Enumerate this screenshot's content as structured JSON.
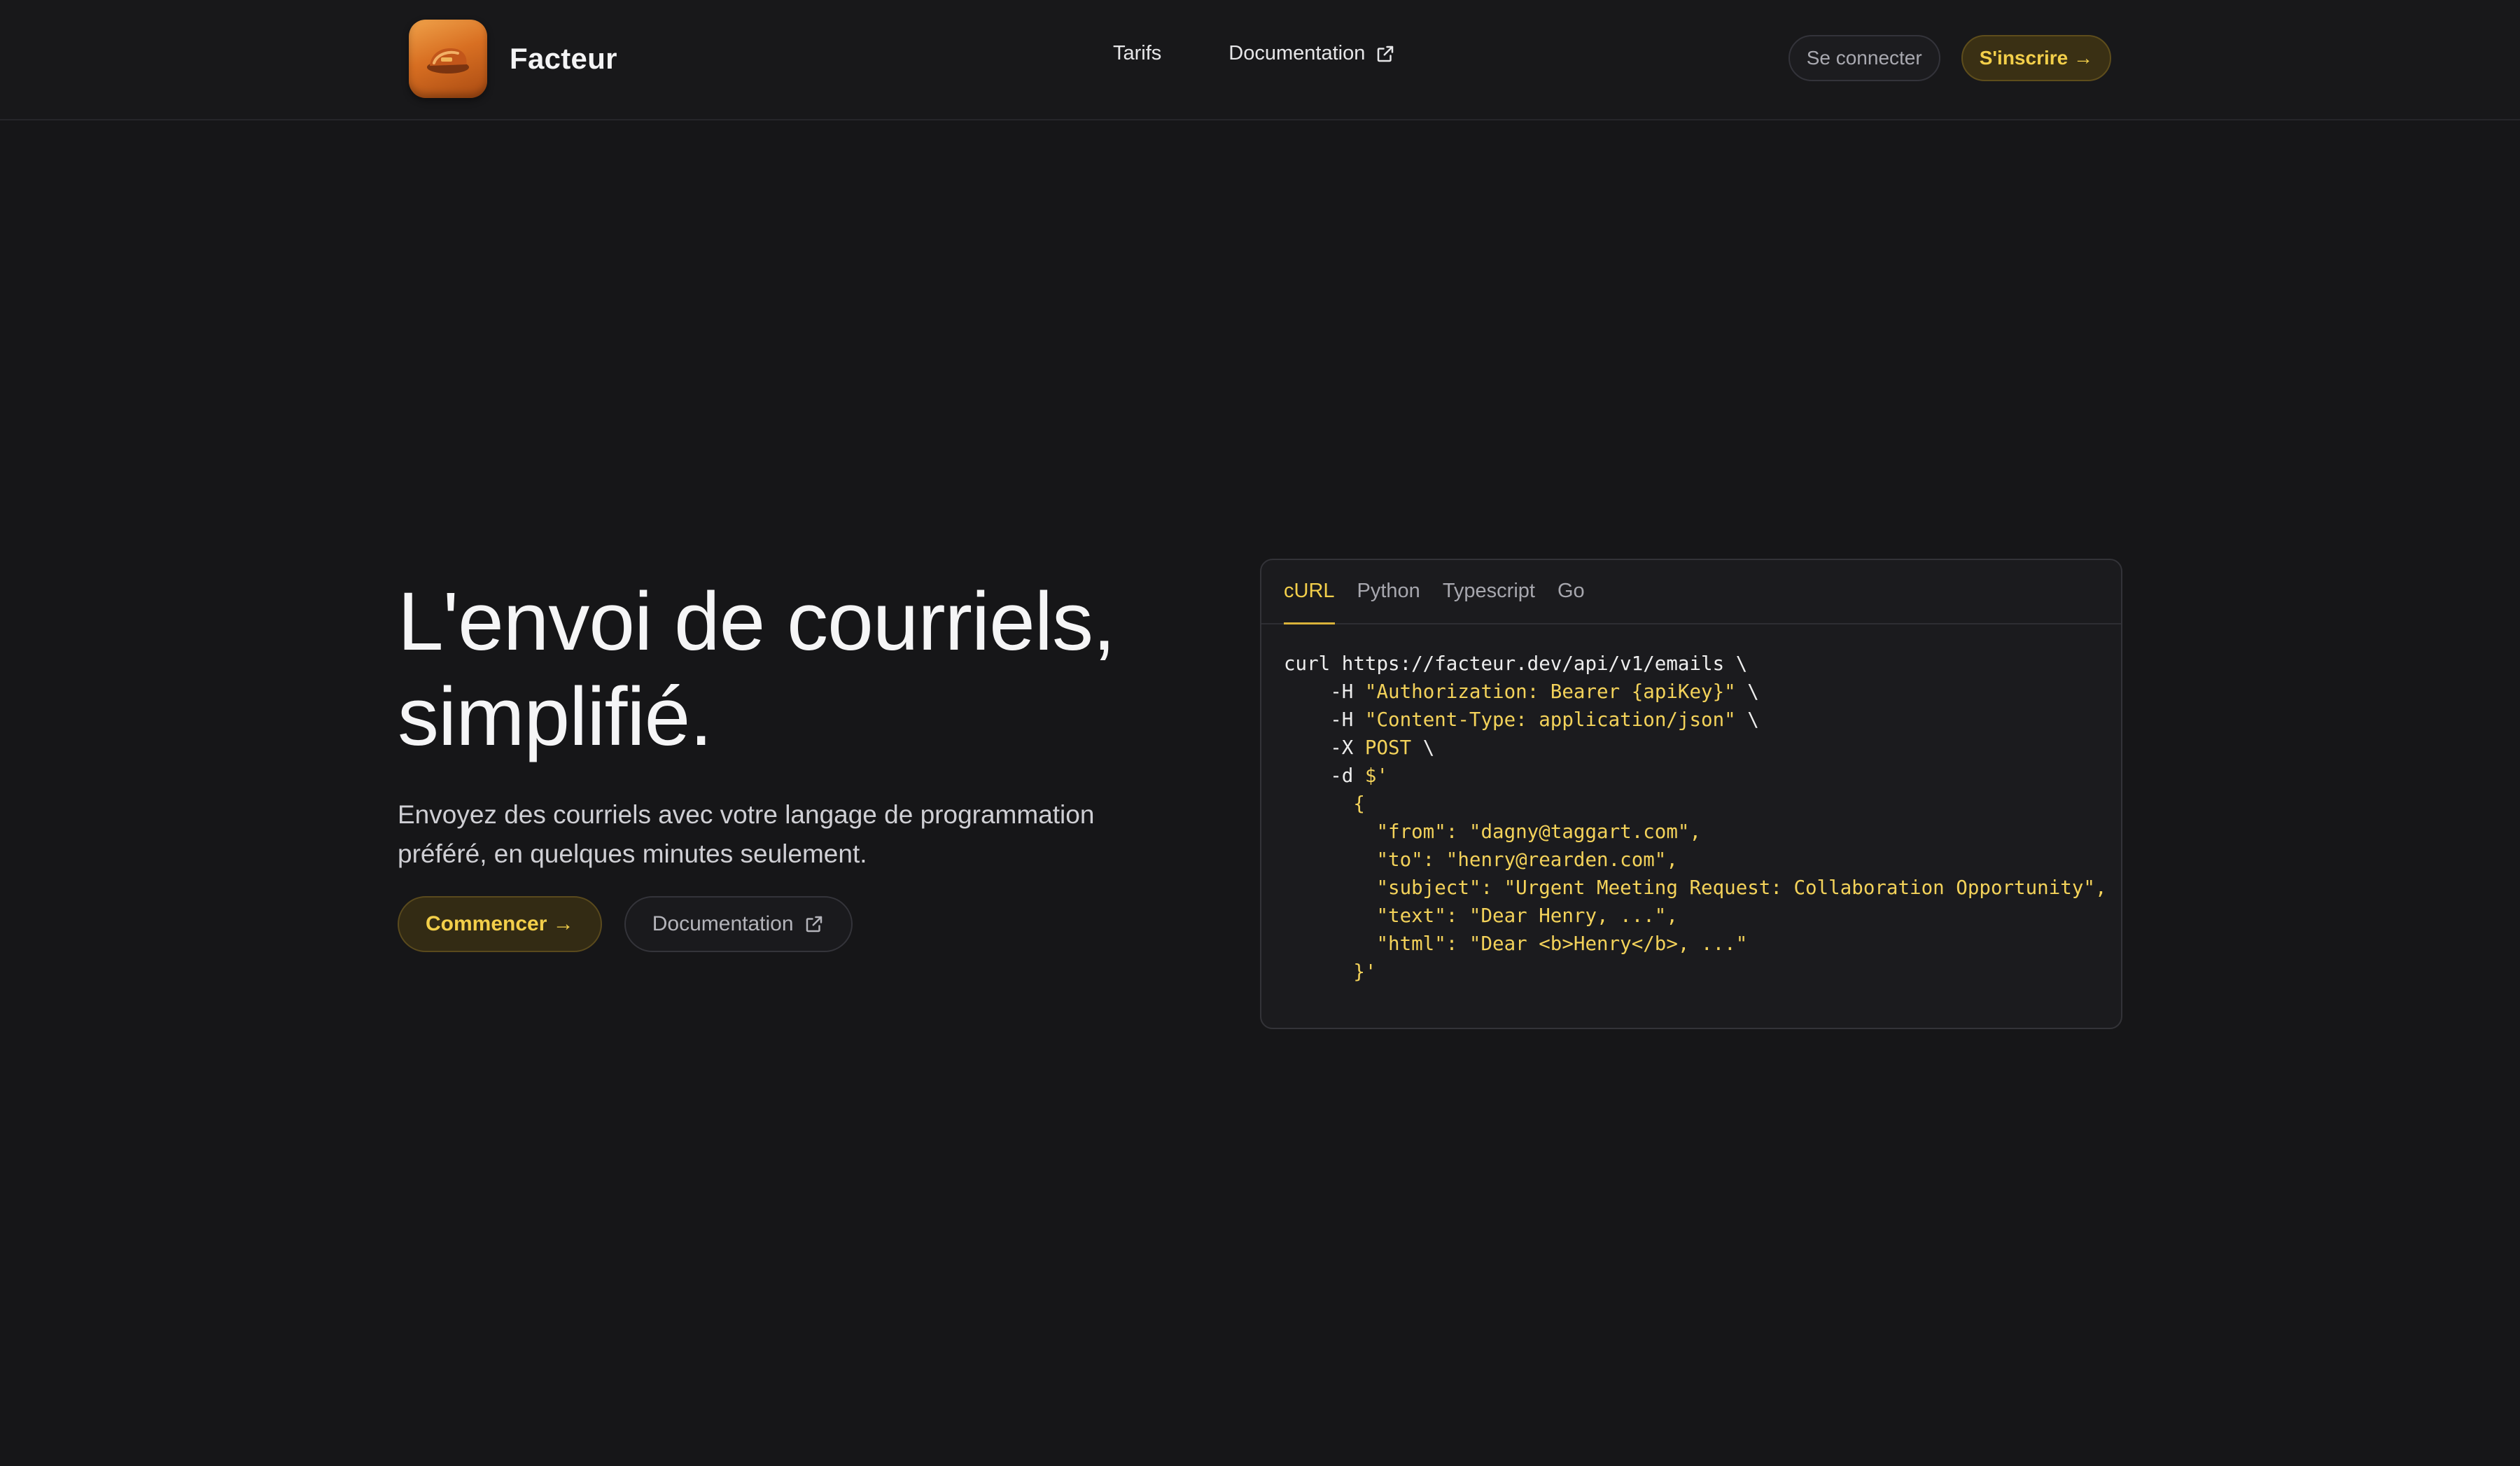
{
  "brand": {
    "name": "Facteur",
    "logo_icon": "postman-cap-icon"
  },
  "nav": {
    "links": [
      {
        "label": "Tarifs"
      },
      {
        "label": "Documentation",
        "icon": "external-link-icon"
      }
    ],
    "login_label": "Se connecter",
    "signup_label": "S'inscrire →"
  },
  "hero": {
    "title": "L'envoi de courriels, simplifié.",
    "subtitle": "Envoyez des courriels avec votre langage de programmation préféré, en quelques minutes seulement.",
    "primary_cta": "Commencer →",
    "secondary_cta": "Documentation"
  },
  "code_card": {
    "tabs": [
      "cURL",
      "Python",
      "Typescript",
      "Go"
    ],
    "active_tab": "cURL",
    "lines": [
      [
        {
          "t": "curl https://facteur.dev/api/v1/emails \\",
          "k": "p"
        }
      ],
      [
        {
          "t": "    -H ",
          "k": "p"
        },
        {
          "t": "\"Authorization: Bearer {apiKey}\"",
          "k": "s"
        },
        {
          "t": " \\",
          "k": "p"
        }
      ],
      [
        {
          "t": "    -H ",
          "k": "p"
        },
        {
          "t": "\"Content-Type: application/json\"",
          "k": "s"
        },
        {
          "t": " \\",
          "k": "p"
        }
      ],
      [
        {
          "t": "    -X ",
          "k": "p"
        },
        {
          "t": "POST",
          "k": "s"
        },
        {
          "t": " \\",
          "k": "p"
        }
      ],
      [
        {
          "t": "    -d ",
          "k": "p"
        },
        {
          "t": "$'",
          "k": "s"
        }
      ],
      [
        {
          "t": "      {",
          "k": "s"
        }
      ],
      [
        {
          "t": "        \"from\": \"dagny@taggart.com\",",
          "k": "s"
        }
      ],
      [
        {
          "t": "        \"to\": \"henry@rearden.com\",",
          "k": "s"
        }
      ],
      [
        {
          "t": "        \"subject\": \"Urgent Meeting Request: Collaboration Opportunity\",",
          "k": "s"
        }
      ],
      [
        {
          "t": "        \"text\": \"Dear Henry, ...\",",
          "k": "s"
        }
      ],
      [
        {
          "t": "        \"html\": \"Dear <b>Henry</b>, ...\"",
          "k": "s"
        }
      ],
      [
        {
          "t": "      }'",
          "k": "s"
        }
      ]
    ]
  },
  "colors": {
    "background": "#161618",
    "accent": "#f3cf4a",
    "logo_orange": "#d86f22"
  }
}
